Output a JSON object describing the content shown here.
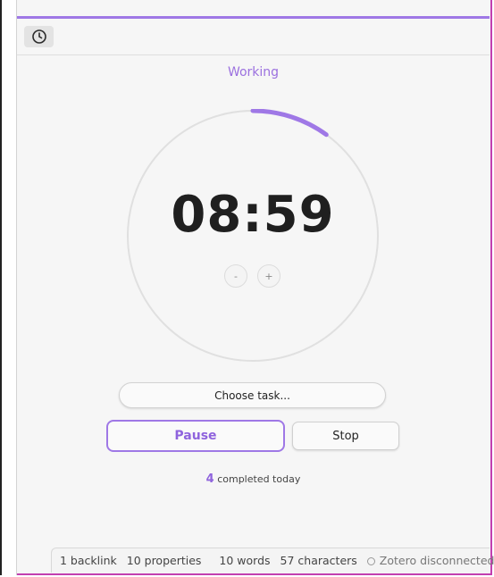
{
  "toolbar": {
    "icon": "clock-icon"
  },
  "timer": {
    "status": "Working",
    "time": "08:59",
    "progress": 0.1,
    "decrement_label": "-",
    "increment_label": "+"
  },
  "actions": {
    "choose_task_label": "Choose task...",
    "pause_label": "Pause",
    "stop_label": "Stop"
  },
  "completed": {
    "count": "4",
    "label": "completed today"
  },
  "statusbar": {
    "backlinks": "1 backlink",
    "properties": "10 properties",
    "edit_icon": "pencil-icon",
    "words": "10 words",
    "characters": "57 characters",
    "zotero": "Zotero disconnected"
  },
  "colors": {
    "accent": "#9f78e6",
    "window_border": "#c23fb0"
  }
}
